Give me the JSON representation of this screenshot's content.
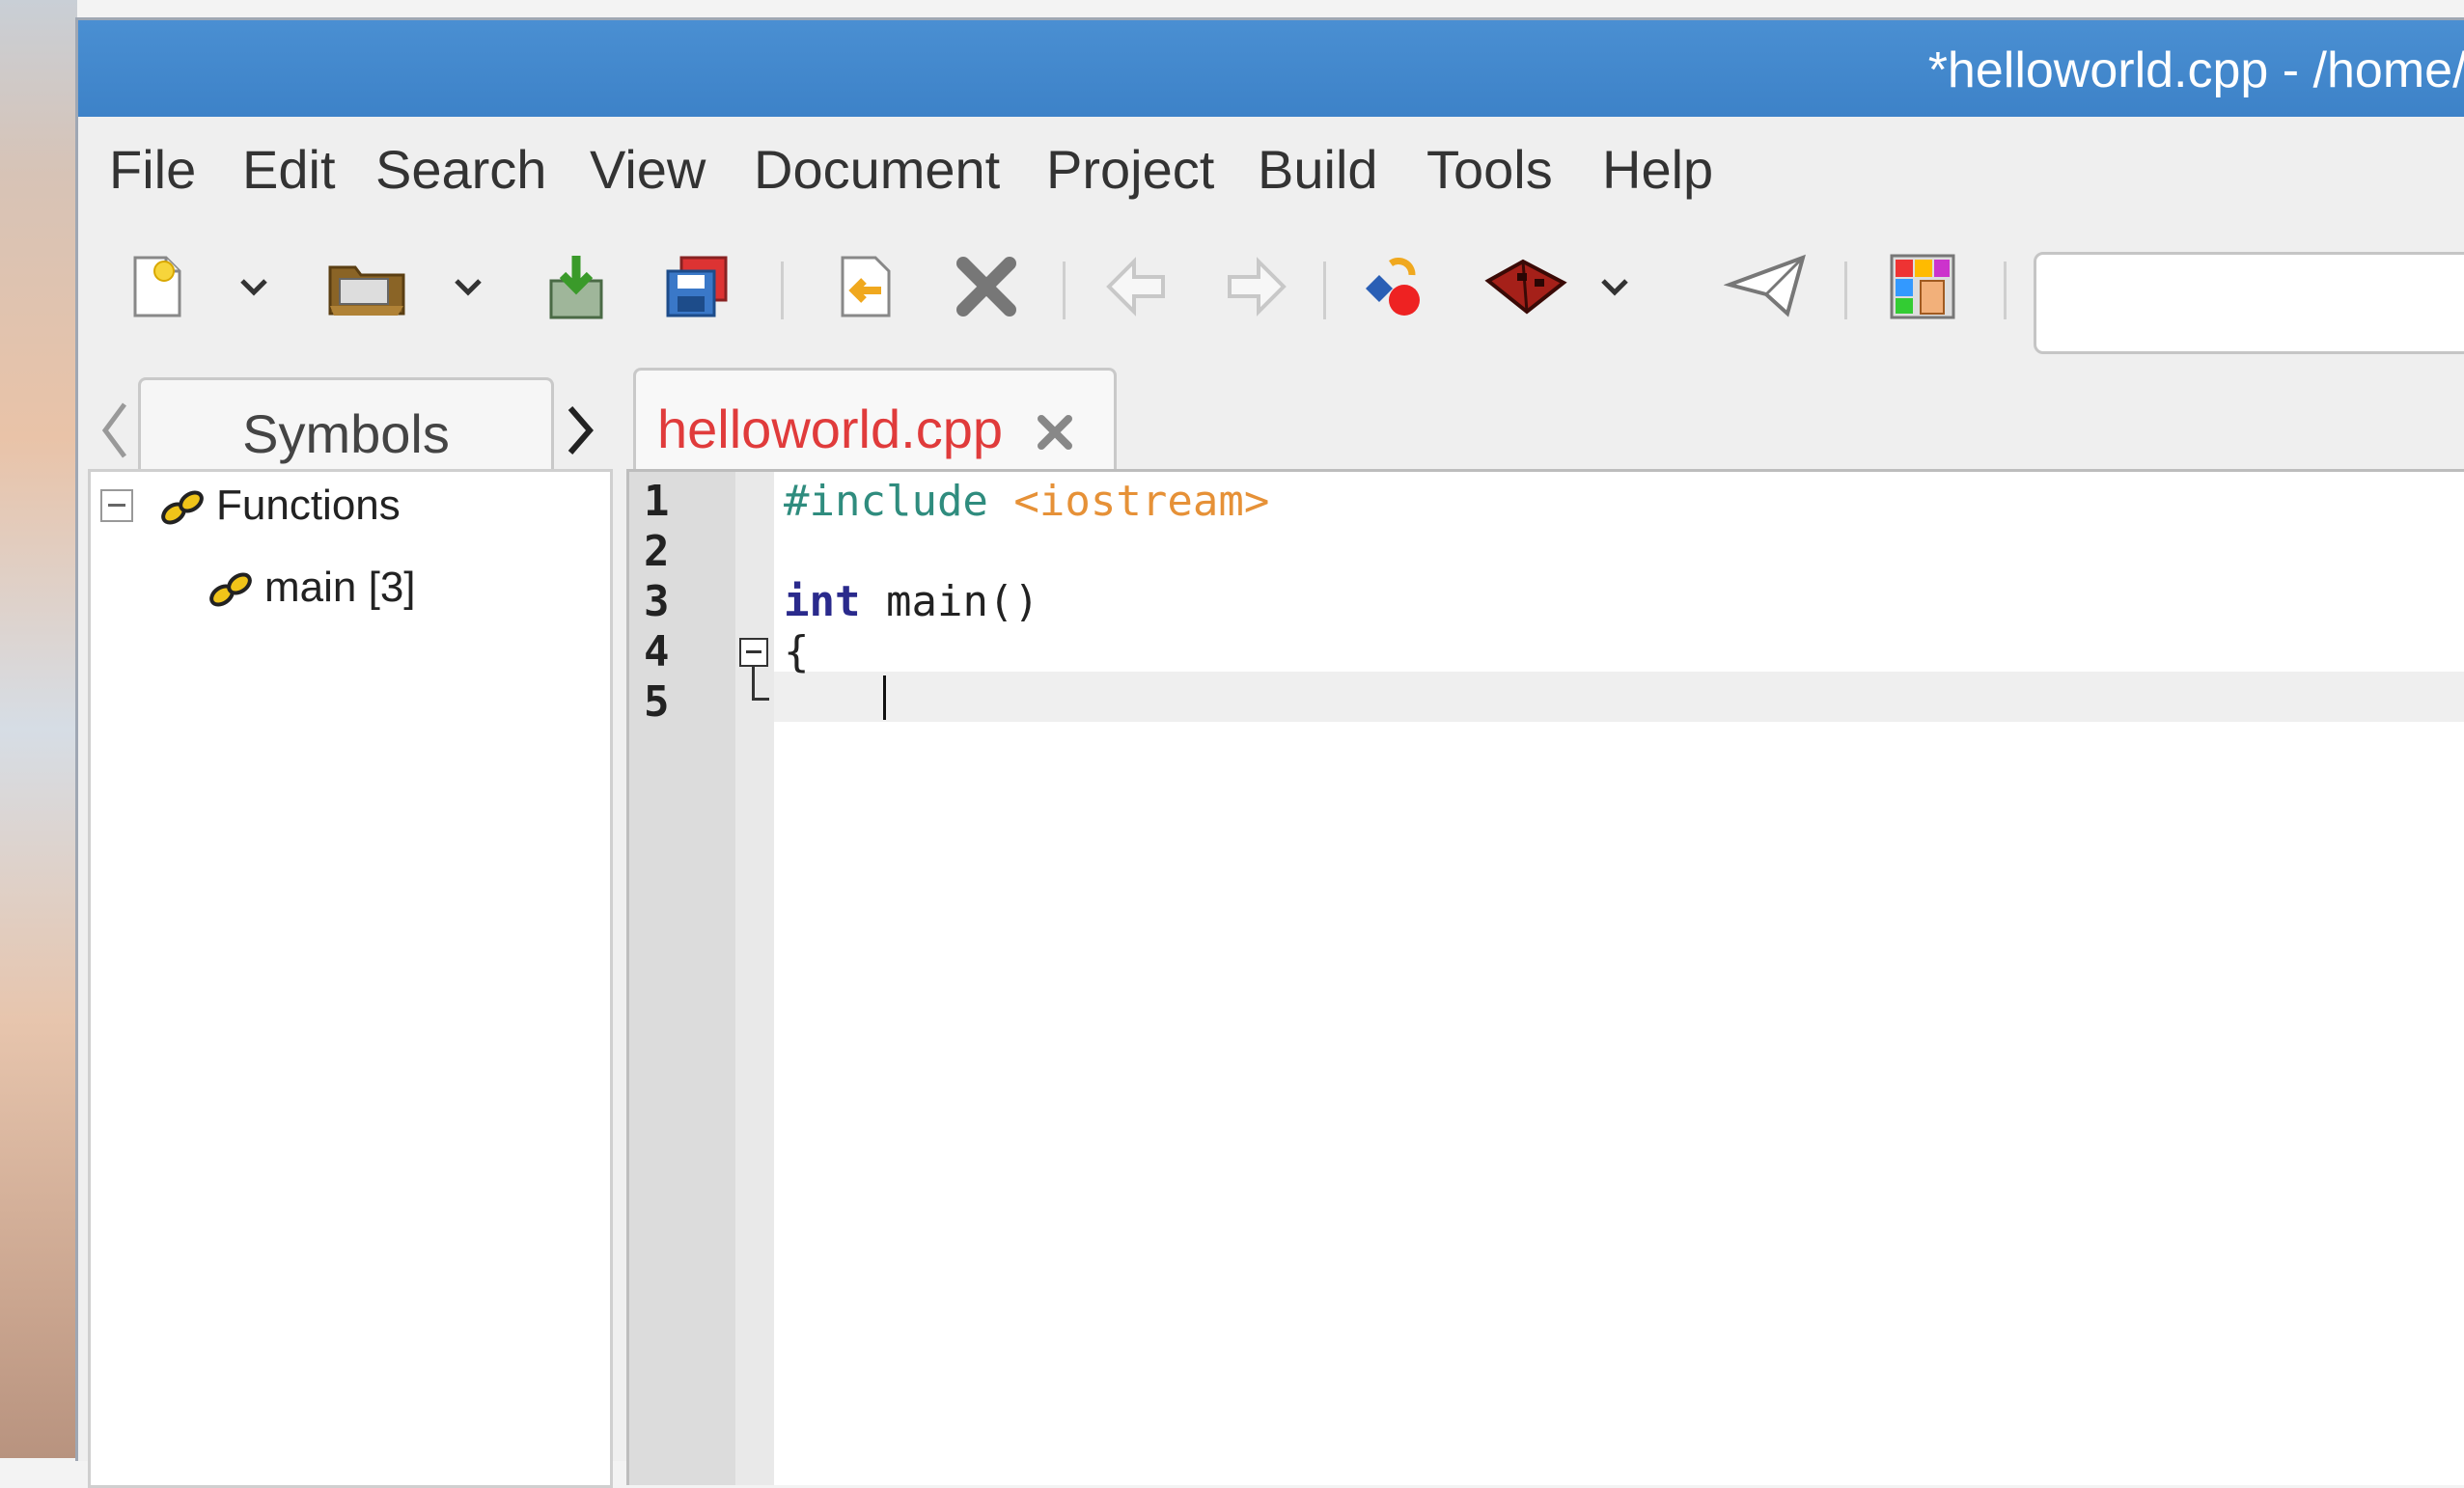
{
  "window": {
    "title": "*helloworld.cpp - /home/pi"
  },
  "menubar": {
    "items": [
      "File",
      "Edit",
      "Search",
      "View",
      "Document",
      "Project",
      "Build",
      "Tools",
      "Help"
    ]
  },
  "toolbar": {
    "icons": [
      "new-file-icon",
      "new-dropdown-icon",
      "open-folder-icon",
      "open-dropdown-icon",
      "save-icon",
      "save-all-icon",
      "revert-icon",
      "close-icon",
      "back-icon",
      "forward-icon",
      "compile-icon",
      "build-icon",
      "build-dropdown-icon",
      "execute-icon",
      "color-chooser-icon"
    ],
    "search_value": ""
  },
  "side_panel": {
    "tab_label": "Symbols",
    "tree": [
      {
        "label": "Functions",
        "expanded": true
      },
      {
        "label": "main [3]"
      }
    ]
  },
  "editor": {
    "tab_label": "helloworld.cpp",
    "lines": [
      "1",
      "2",
      "3",
      "4",
      "5"
    ],
    "code": {
      "line1_directive": "#include",
      "line1_header": "<iostream>",
      "line3_keyword": "int",
      "line3_rest": "main()",
      "line4": "{"
    },
    "colors": {
      "directive": "#2f8c7e",
      "header": "#e69137",
      "keyword": "#2a2a8c",
      "tab_label": "#e03b3b"
    }
  }
}
